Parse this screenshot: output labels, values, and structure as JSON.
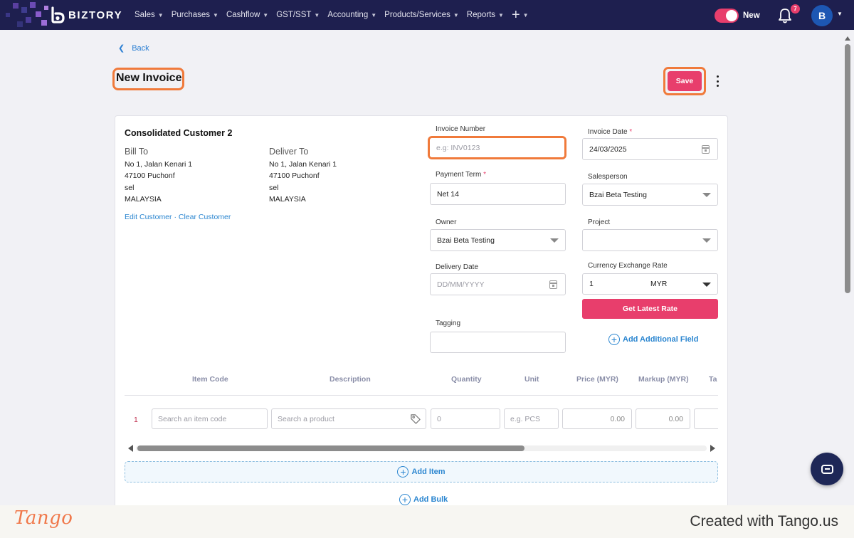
{
  "nav": {
    "brand": "BIZTORY",
    "menu": [
      {
        "label": "Sales"
      },
      {
        "label": "Purchases"
      },
      {
        "label": "Cashflow"
      },
      {
        "label": "GST/SST"
      },
      {
        "label": "Accounting"
      },
      {
        "label": "Products/Services"
      },
      {
        "label": "Reports"
      }
    ],
    "plus_label": "+",
    "toggle_label": "New",
    "notification_count": "7",
    "avatar_initial": "B"
  },
  "header": {
    "back_label": "Back",
    "title": "New Invoice",
    "save_label": "Save"
  },
  "customer": {
    "name": "Consolidated Customer 2",
    "bill_to": {
      "heading": "Bill To",
      "lines": [
        "No 1, Jalan Kenari 1",
        "47100 Puchonf",
        "sel",
        "MALAYSIA"
      ]
    },
    "deliver_to": {
      "heading": "Deliver To",
      "lines": [
        "No 1, Jalan Kenari 1",
        "47100 Puchonf",
        "sel",
        "MALAYSIA"
      ]
    },
    "edit_label": "Edit Customer",
    "separator": " · ",
    "clear_label": "Clear Customer"
  },
  "form": {
    "invoice_number": {
      "label": "Invoice Number",
      "placeholder": "e.g: INV0123",
      "value": ""
    },
    "invoice_date": {
      "label": "Invoice Date",
      "required_mark": "*",
      "value": "24/03/2025"
    },
    "payment_term": {
      "label": "Payment Term",
      "required_mark": "*",
      "value": "Net 14"
    },
    "salesperson": {
      "label": "Salesperson",
      "value": "Bzai Beta Testing"
    },
    "owner": {
      "label": "Owner",
      "value": "Bzai Beta Testing"
    },
    "project": {
      "label": "Project",
      "value": ""
    },
    "delivery_date": {
      "label": "Delivery Date",
      "placeholder": "DD/MM/YYYY"
    },
    "currency": {
      "label": "Currency Exchange Rate",
      "rate": "1",
      "code": "MYR"
    },
    "get_rate_label": "Get Latest Rate",
    "tagging": {
      "label": "Tagging",
      "value": ""
    },
    "add_field_label": "Add Additional Field"
  },
  "table": {
    "columns": [
      "Item Code",
      "Description",
      "Quantity",
      "Unit",
      "Price (MYR)",
      "Markup (MYR)",
      "Ta"
    ],
    "rows": [
      {
        "num": "1",
        "item_code_placeholder": "Search an item code",
        "product_placeholder": "Search a product",
        "quantity": "0",
        "unit_placeholder": "e.g. PCS",
        "price": "0.00",
        "markup": "0.00"
      }
    ],
    "add_item_label": "Add Item",
    "add_bulk_label": "Add Bulk"
  },
  "footer": {
    "logo": "Tango",
    "credit": "Created with Tango.us"
  },
  "colors": {
    "nav_bg": "#1e1f4f",
    "accent": "#e83e6c",
    "link": "#2b86d0",
    "highlight": "#f07a3b",
    "tango": "#f0784a"
  }
}
